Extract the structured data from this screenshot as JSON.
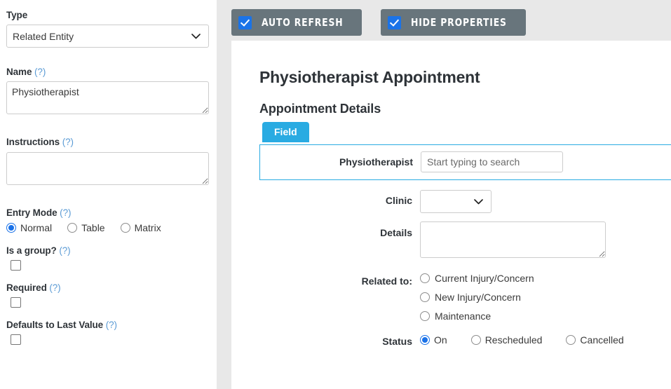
{
  "sidebar": {
    "type": {
      "label": "Type",
      "value": "Related Entity",
      "options": [
        "Related Entity"
      ]
    },
    "name": {
      "label": "Name",
      "help": "(?)",
      "value": "Physiotherapist"
    },
    "instructions": {
      "label": "Instructions",
      "help": "(?)",
      "value": ""
    },
    "entry_mode": {
      "label": "Entry Mode",
      "help": "(?)",
      "options": [
        {
          "label": "Normal",
          "checked": true
        },
        {
          "label": "Table",
          "checked": false
        },
        {
          "label": "Matrix",
          "checked": false
        }
      ]
    },
    "is_a_group": {
      "label": "Is a group?",
      "help": "(?)",
      "checked": false
    },
    "required": {
      "label": "Required",
      "help": "(?)",
      "checked": false
    },
    "defaults_to_last_value": {
      "label": "Defaults to Last Value",
      "help": "(?)",
      "checked": false
    }
  },
  "toolbar": {
    "auto_refresh": {
      "label": "Auto Refresh",
      "checked": true
    },
    "hide_properties": {
      "label": "Hide Properties",
      "checked": true
    }
  },
  "preview": {
    "page_title": "Physiotherapist Appointment",
    "section_title": "Appointment Details",
    "tab": {
      "label": "Field",
      "active": true
    },
    "physiotherapist": {
      "label": "Physiotherapist",
      "value": "",
      "placeholder": "Start typing to search"
    },
    "clinic": {
      "label": "Clinic",
      "value": "",
      "options": [
        ""
      ]
    },
    "details": {
      "label": "Details",
      "value": ""
    },
    "related_to": {
      "label": "Related to:",
      "options": [
        {
          "label": "Current Injury/Concern",
          "checked": false
        },
        {
          "label": "New Injury/Concern",
          "checked": false
        },
        {
          "label": "Maintenance",
          "checked": false
        }
      ]
    },
    "status": {
      "label": "Status",
      "options": [
        {
          "label": "On",
          "checked": true
        },
        {
          "label": "Rescheduled",
          "checked": false
        },
        {
          "label": "Cancelled",
          "checked": false
        }
      ]
    }
  },
  "colors": {
    "accent_blue": "#29abe2",
    "checkbox_blue": "#1a73e8",
    "toolbar_button_gray": "#68757c",
    "page_background": "#e8e8e8",
    "help_link": "#5b9bd5"
  }
}
